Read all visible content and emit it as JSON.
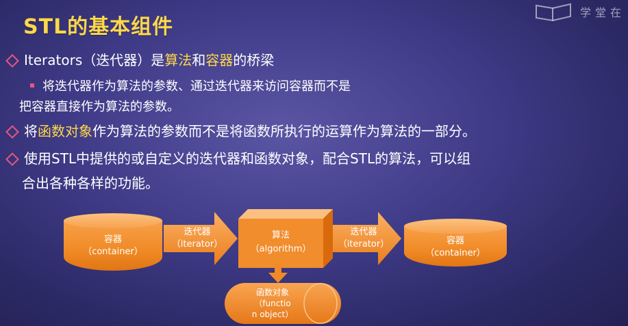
{
  "slide": {
    "title": "STL的基本组件",
    "watermark": "学堂在",
    "bullet1": {
      "prefix": "Iterators（迭代器）是",
      "hl1": "算法",
      "mid": "和",
      "hl2": "容器",
      "suffix": "的桥梁"
    },
    "sub1_line1": "将迭代器作为算法的参数、通过迭代器来访问容器而不是",
    "sub1_line2": "把容器直接作为算法的参数。",
    "bullet2": {
      "prefix": "将",
      "hl": "函数对象",
      "suffix": "作为算法的参数而不是将函数所执行的运算作为算法的一部分。"
    },
    "bullet3_line1": "使用STL中提供的或自定义的迭代器和函数对象，配合STL的算法，可以组",
    "bullet3_line2": "合出各种各样的功能。"
  },
  "diagram": {
    "container_left": {
      "label": "容器",
      "sub": "（container）"
    },
    "arrow1": {
      "label": "迭代器",
      "sub": "（iterator）"
    },
    "algorithm": {
      "label": "算法",
      "sub": "（algorithm）"
    },
    "arrow2": {
      "label": "迭代器",
      "sub": "（iterator）"
    },
    "container_right": {
      "label": "容器",
      "sub": "（container）"
    },
    "function_object": {
      "line1": "函数对象",
      "line2": "（functio",
      "line3": "n object）"
    }
  },
  "colors": {
    "accent_yellow": "#ffd84a",
    "bullet_pink": "#e8577e",
    "shape_orange": "#f08a26",
    "background": "#3e3a86"
  }
}
